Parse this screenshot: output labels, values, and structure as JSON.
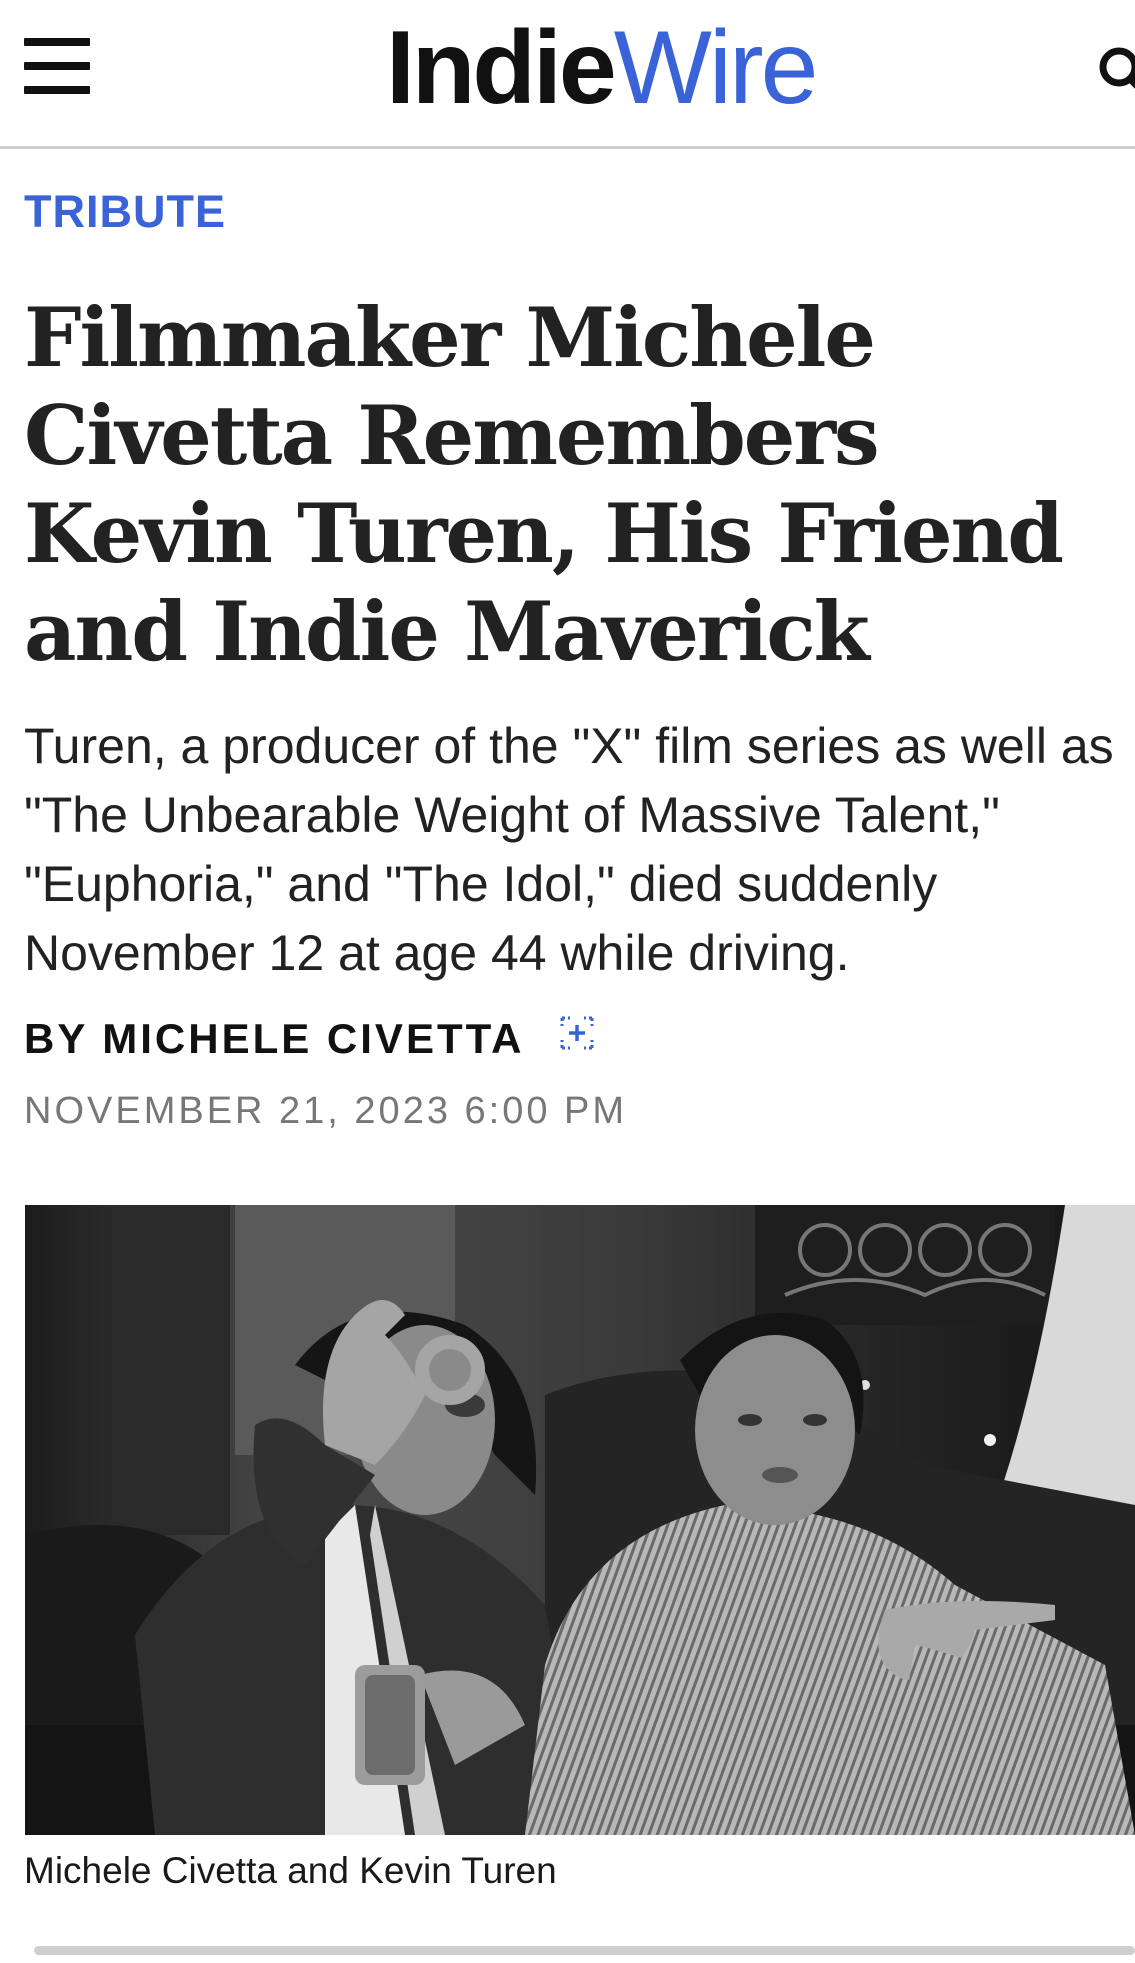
{
  "header": {
    "logo_bold": "Indie",
    "logo_light": "Wire",
    "menu_icon": "hamburger-menu-icon",
    "search_icon": "search-icon",
    "brand_color": "#3a63d8"
  },
  "article": {
    "category": "TRIBUTE",
    "headline": "Filmmaker Michele Civetta Remembers Kevin Turen, His Friend and Indie Maverick",
    "dek": "Turen, a producer of the \"X\" film series as well as \"The Unbearable Weight of Massive Talent,\" \"Euphoria,\" and \"The Idol,\" died suddenly November 12 at age 44 while driving.",
    "byline_prefix": "BY",
    "author": "MICHELE CIVETTA",
    "author_follow_icon": "follow-author-plus-icon",
    "date": "NOVEMBER 21, 2023 6:00 PM",
    "photo_caption": "Michele Civetta and Kevin Turen"
  }
}
